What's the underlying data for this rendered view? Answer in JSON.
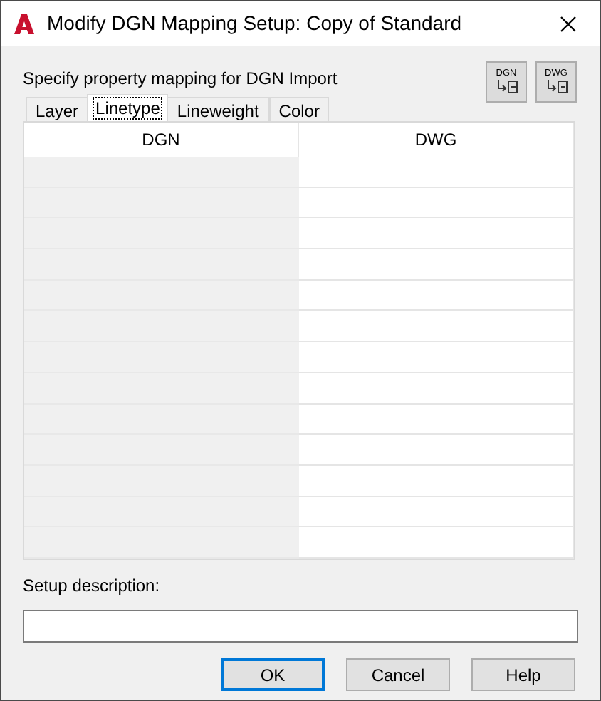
{
  "window": {
    "title": "Modify DGN Mapping Setup: Copy of Standard"
  },
  "instruction": "Specify property mapping for DGN Import",
  "tool_buttons": [
    {
      "label": "DGN"
    },
    {
      "label": "DWG"
    }
  ],
  "tabs": [
    {
      "label": "Layer",
      "selected": false
    },
    {
      "label": "Linetype",
      "selected": true
    },
    {
      "label": "Lineweight",
      "selected": false
    },
    {
      "label": "Color",
      "selected": false
    }
  ],
  "table": {
    "columns": [
      "DGN",
      "DWG"
    ]
  },
  "setup_description": {
    "label": "Setup description:"
  },
  "buttons": [
    {
      "label": "OK",
      "default": true
    },
    {
      "label": "Cancel",
      "default": false
    },
    {
      "label": "Help",
      "default": false
    }
  ]
}
